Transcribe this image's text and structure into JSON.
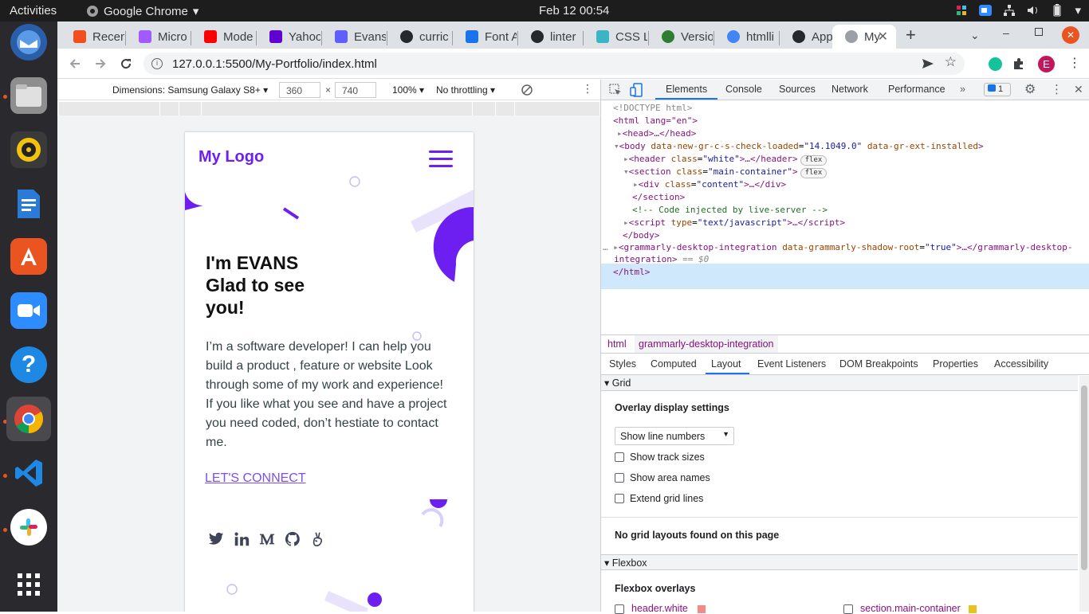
{
  "topbar": {
    "activities": "Activities",
    "app": "Google Chrome",
    "clock": "Feb 12  00:54"
  },
  "tabs": [
    {
      "label": "Recen",
      "color": "#f24e1e"
    },
    {
      "label": "Micro",
      "color": "#a259ff"
    },
    {
      "label": "Mode",
      "color": "#ff0000"
    },
    {
      "label": "Yahoo",
      "color": "#6001d2"
    },
    {
      "label": "Evans",
      "color": "#5f5fff"
    },
    {
      "label": "curric",
      "color": "#24292e"
    },
    {
      "label": "Font A",
      "color": "#1a73e8"
    },
    {
      "label": "linter",
      "color": "#24292e"
    },
    {
      "label": "CSS Li",
      "color": "#3bb4c6"
    },
    {
      "label": "Versio",
      "color": "#2e7d32"
    },
    {
      "label": "htmlli",
      "color": "#4285f4"
    },
    {
      "label": "Appe",
      "color": "#24292e"
    },
    {
      "label": "My",
      "color": "#9aa0a6"
    }
  ],
  "url": "127.0.0.1:5500/My-Portfolio/index.html",
  "profile_initial": "E",
  "devbar": {
    "dimensions": "Dimensions: Samsung Galaxy S8+",
    "width": "360",
    "height": "740",
    "zoom": "100%",
    "throttle": "No throttling",
    "times": "×"
  },
  "page": {
    "logo": "My Logo",
    "title_lines": [
      "I'm EVANS",
      "Glad to see",
      "you!"
    ],
    "text": "I’m a software developer! I can help you build a product , feature or website Look through some of my work and experience! If you like what you see and have a project you need coded, don’t hestiate to contact me.",
    "connect": "LET'S CONNECT",
    "accent": "#6c1ff0"
  },
  "devtools": {
    "tabs": [
      "Elements",
      "Console",
      "Sources",
      "Network",
      "Performance"
    ],
    "more": "»",
    "issues": "1",
    "dom": {
      "doctype": "<!DOCTYPE html>",
      "html_open": "<html lang=\"en\">",
      "head": "<head>…</head>",
      "body_tag": "body",
      "body_attr1": "data-new-gr-c-s-check-loaded",
      "body_val1": "\"14.1049.0\"",
      "body_attr2": "data-gr-ext-installed",
      "header": "header",
      "header_class": "\"white\"",
      "section": "section",
      "section_class": "\"main-container\"",
      "div_class": "\"content\"",
      "comment": "<!-- Code injected by live-server -->",
      "script_type": "\"text/javascript\"",
      "body_close": "</body>",
      "gram_attr": "data-grammarly-shadow-root",
      "gram_val": "\"true\"",
      "gram_cont": "integration",
      "eq": "== $0",
      "html_close": "</html>",
      "flex": "flex",
      "class_attr": "class",
      "type_attr": "type"
    },
    "crumbs": [
      "html",
      "grammarly-desktop-integration"
    ],
    "subtabs": [
      "Styles",
      "Computed",
      "Layout",
      "Event Listeners",
      "DOM Breakpoints",
      "Properties",
      "Accessibility"
    ],
    "layout": {
      "grid": "Grid",
      "overlay": "Overlay display settings",
      "select": "Show line numbers",
      "opts": [
        "Show track sizes",
        "Show area names",
        "Extend grid lines"
      ],
      "none": "No grid layouts found on this page",
      "flexbox": "Flexbox",
      "flex_overlays": "Flexbox overlays",
      "flex_items": [
        "header.white",
        "section.main-container"
      ]
    }
  }
}
